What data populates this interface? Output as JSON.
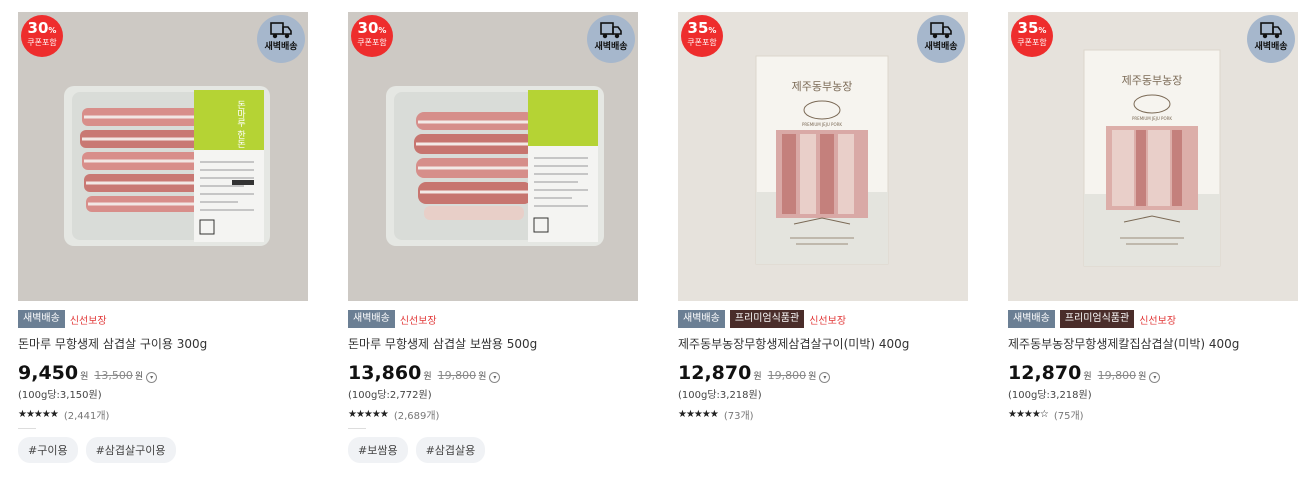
{
  "products": [
    {
      "discount": "30",
      "discount_pct": "%",
      "coupon": "쿠폰포함",
      "delivery_badge": "새벽배송",
      "tags": [
        "새벽배송"
      ],
      "premium": "",
      "fresh": "신선보장",
      "name": "돈마루 무항생제 삼겹살 구이용 300g",
      "price": "9,450",
      "won": "원",
      "original": "13,500",
      "unit": "(100g당:3,150원)",
      "stars": "★★★★★",
      "reviews": "(2,441개)",
      "hashtags": [
        "#구이용",
        "#삼겹살구이용"
      ]
    },
    {
      "discount": "30",
      "discount_pct": "%",
      "coupon": "쿠폰포함",
      "delivery_badge": "새벽배송",
      "tags": [
        "새벽배송"
      ],
      "premium": "",
      "fresh": "신선보장",
      "name": "돈마루 무항생제 삼겹살 보쌈용 500g",
      "price": "13,860",
      "won": "원",
      "original": "19,800",
      "unit": "(100g당:2,772원)",
      "stars": "★★★★★",
      "reviews": "(2,689개)",
      "hashtags": [
        "#보쌈용",
        "#삼겹살용"
      ]
    },
    {
      "discount": "35",
      "discount_pct": "%",
      "coupon": "쿠폰포함",
      "delivery_badge": "새벽배송",
      "tags": [
        "새벽배송"
      ],
      "premium": "프리미엄식품관",
      "fresh": "신선보장",
      "name": "제주동부농장무항생제삼겹살구이(미박) 400g",
      "price": "12,870",
      "won": "원",
      "original": "19,800",
      "unit": "(100g당:3,218원)",
      "stars": "★★★★★",
      "reviews": "(73개)",
      "hashtags": []
    },
    {
      "discount": "35",
      "discount_pct": "%",
      "coupon": "쿠폰포함",
      "delivery_badge": "새벽배송",
      "tags": [
        "새벽배송"
      ],
      "premium": "프리미엄식품관",
      "fresh": "신선보장",
      "name": "제주동부농장무항생제칼집삼겹살(미박) 400g",
      "price": "12,870",
      "won": "원",
      "original": "19,800",
      "unit": "(100g당:3,218원)",
      "stars": "★★★★☆",
      "reviews": "(75개)",
      "hashtags": []
    }
  ],
  "package_text": {
    "brand_green": "돈마루 한돈",
    "farm_name": "제주동부농장",
    "farm_en": "PREMIUM JEJU PORK"
  },
  "colors": {
    "discount": "#ee2d2d",
    "dawn": "#a6b7cc",
    "badge_grey": "#6b7f94",
    "badge_premium": "#4a2d2a",
    "fresh": "#e23a3a"
  }
}
